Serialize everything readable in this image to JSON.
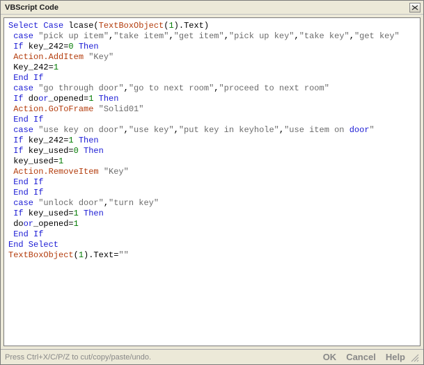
{
  "window": {
    "title": "VBScript Code"
  },
  "statusbar": {
    "hint": "Press Ctrl+X/C/P/Z to cut/copy/paste/undo.",
    "ok": "OK",
    "cancel": "Cancel",
    "help": "Help"
  },
  "code": {
    "lines": [
      [
        [
          "kw",
          "Select Case"
        ],
        [
          "txt",
          " lcase("
        ],
        [
          "func",
          "TextBoxObject"
        ],
        [
          "txt",
          "("
        ],
        [
          "num",
          "1"
        ],
        [
          "txt",
          ").Text)"
        ]
      ],
      [
        [
          "txt",
          " "
        ],
        [
          "kw",
          "case"
        ],
        [
          "txt",
          " "
        ],
        [
          "str",
          "\"pick up item\""
        ],
        [
          "txt",
          ","
        ],
        [
          "str",
          "\"take item\""
        ],
        [
          "txt",
          ","
        ],
        [
          "str",
          "\"get item\""
        ],
        [
          "txt",
          ","
        ],
        [
          "str",
          "\"pick up key\""
        ],
        [
          "txt",
          ","
        ],
        [
          "str",
          "\"take key\""
        ],
        [
          "txt",
          ","
        ],
        [
          "str",
          "\"get key\""
        ]
      ],
      [
        [
          "txt",
          " "
        ],
        [
          "kw",
          "If"
        ],
        [
          "txt",
          " key_242="
        ],
        [
          "num",
          "0"
        ],
        [
          "txt",
          " "
        ],
        [
          "kw",
          "Then"
        ]
      ],
      [
        [
          "txt",
          " "
        ],
        [
          "func",
          "Action.AddItem"
        ],
        [
          "txt",
          " "
        ],
        [
          "str",
          "\"Key\""
        ]
      ],
      [
        [
          "txt",
          " Key_242="
        ],
        [
          "num",
          "1"
        ]
      ],
      [
        [
          "txt",
          " "
        ],
        [
          "kw",
          "End If"
        ]
      ],
      [
        [
          "txt",
          " "
        ],
        [
          "kw",
          "case"
        ],
        [
          "txt",
          " "
        ],
        [
          "str",
          "\"go through door\""
        ],
        [
          "txt",
          ","
        ],
        [
          "str",
          "\"go to next room\""
        ],
        [
          "txt",
          ","
        ],
        [
          "str",
          "\"proceed to next room\""
        ]
      ],
      [
        [
          "txt",
          " "
        ],
        [
          "kw",
          "If"
        ],
        [
          "txt",
          " do"
        ],
        [
          "kw",
          "or"
        ],
        [
          "txt",
          "_opened="
        ],
        [
          "num",
          "1"
        ],
        [
          "txt",
          " "
        ],
        [
          "kw",
          "Then"
        ]
      ],
      [
        [
          "txt",
          " "
        ],
        [
          "func",
          "Action.GoToFrame"
        ],
        [
          "txt",
          " "
        ],
        [
          "str",
          "\"Solid01\""
        ]
      ],
      [
        [
          "txt",
          " "
        ],
        [
          "kw",
          "End If"
        ]
      ],
      [
        [
          "txt",
          " "
        ],
        [
          "kw",
          "case"
        ],
        [
          "txt",
          " "
        ],
        [
          "str",
          "\"use key on door\""
        ],
        [
          "txt",
          ","
        ],
        [
          "str",
          "\"use key\""
        ],
        [
          "txt",
          ","
        ],
        [
          "str",
          "\"put key in keyhole\""
        ],
        [
          "txt",
          ","
        ],
        [
          "str",
          "\"use item on "
        ],
        [
          "kw",
          "door"
        ],
        [
          "str",
          "\""
        ]
      ],
      [
        [
          "txt",
          " "
        ],
        [
          "kw",
          "If"
        ],
        [
          "txt",
          " key_242="
        ],
        [
          "num",
          "1"
        ],
        [
          "txt",
          " "
        ],
        [
          "kw",
          "Then"
        ]
      ],
      [
        [
          "txt",
          " "
        ],
        [
          "kw",
          "If"
        ],
        [
          "txt",
          " key_used="
        ],
        [
          "num",
          "0"
        ],
        [
          "txt",
          " "
        ],
        [
          "kw",
          "Then"
        ]
      ],
      [
        [
          "txt",
          " key_used="
        ],
        [
          "num",
          "1"
        ]
      ],
      [
        [
          "txt",
          " "
        ],
        [
          "func",
          "Action.RemoveItem"
        ],
        [
          "txt",
          " "
        ],
        [
          "str",
          "\"Key\""
        ]
      ],
      [
        [
          "txt",
          " "
        ],
        [
          "kw",
          "End If"
        ]
      ],
      [
        [
          "txt",
          " "
        ],
        [
          "kw",
          "End If"
        ]
      ],
      [
        [
          "txt",
          " "
        ],
        [
          "kw",
          "case"
        ],
        [
          "txt",
          " "
        ],
        [
          "str",
          "\"unlock door\""
        ],
        [
          "txt",
          ","
        ],
        [
          "str",
          "\"turn key\""
        ]
      ],
      [
        [
          "txt",
          " "
        ],
        [
          "kw",
          "If"
        ],
        [
          "txt",
          " key_used="
        ],
        [
          "num",
          "1"
        ],
        [
          "txt",
          " "
        ],
        [
          "kw",
          "Then"
        ]
      ],
      [
        [
          "txt",
          " do"
        ],
        [
          "kw",
          "or"
        ],
        [
          "txt",
          "_opened="
        ],
        [
          "num",
          "1"
        ]
      ],
      [
        [
          "txt",
          " "
        ],
        [
          "kw",
          "End If"
        ]
      ],
      [
        [
          "kw",
          "End Select"
        ]
      ],
      [
        [
          "func",
          "TextBoxObject"
        ],
        [
          "txt",
          "("
        ],
        [
          "num",
          "1"
        ],
        [
          "txt",
          ").Text="
        ],
        [
          "str",
          "\"\""
        ]
      ]
    ]
  }
}
